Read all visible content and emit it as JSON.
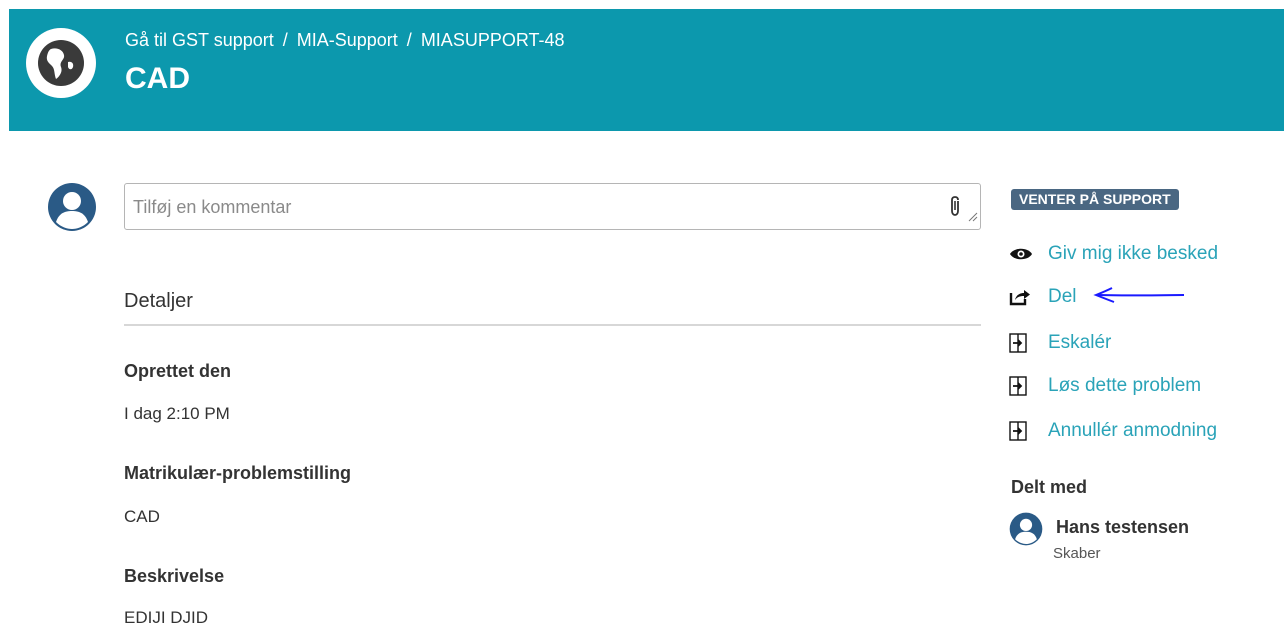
{
  "header": {
    "breadcrumb": [
      "Gå til GST support",
      "MIA-Support",
      "MIASUPPORT-48"
    ],
    "separator": "/",
    "title": "CAD",
    "background_color": "#0c98ad"
  },
  "comment": {
    "placeholder": "Tilføj en kommentar",
    "value": ""
  },
  "details": {
    "section_title": "Detaljer",
    "fields": [
      {
        "label": "Oprettet den",
        "value": "I dag 2:10 PM"
      },
      {
        "label": "Matrikulær-problemstilling",
        "value": "CAD"
      },
      {
        "label": "Beskrivelse",
        "value": "EDIJI DJID"
      }
    ]
  },
  "sidebar": {
    "status": "VENTER PÅ SUPPORT",
    "actions": [
      {
        "label": "Giv mig ikke besked",
        "icon": "eye-icon"
      },
      {
        "label": "Del",
        "icon": "share-icon"
      },
      {
        "label": "Eskalér",
        "icon": "transition-icon"
      },
      {
        "label": "Løs dette problem",
        "icon": "transition-icon"
      },
      {
        "label": "Annullér anmodning",
        "icon": "transition-icon"
      }
    ],
    "shared_with": {
      "title": "Delt med",
      "name": "Hans testensen",
      "role": "Skaber"
    }
  },
  "colors": {
    "link": "#2aa3b8",
    "badge": "#4a6782",
    "annotation_arrow": "#1a1aff"
  }
}
